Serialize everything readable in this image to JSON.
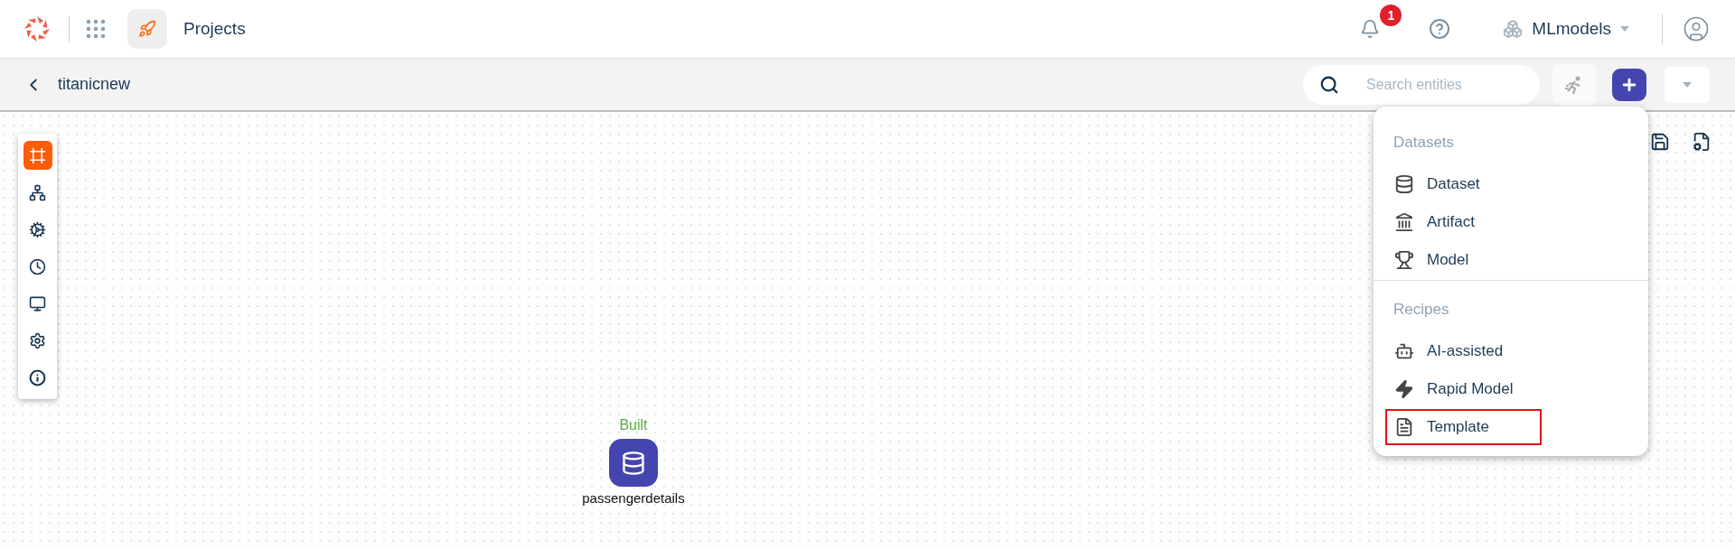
{
  "header": {
    "app_title": "Projects",
    "notifications": {
      "count": "1"
    },
    "workspace": "MLmodels"
  },
  "subheader": {
    "title": "titanicnew",
    "search": {
      "placeholder": "Search entities"
    }
  },
  "toolbar": {
    "items": [
      {
        "kind": "canvas",
        "selected": true
      },
      {
        "kind": "tree",
        "selected": false
      },
      {
        "kind": "pipeline",
        "selected": false
      },
      {
        "kind": "clock",
        "selected": false
      },
      {
        "kind": "dashboard",
        "selected": false
      },
      {
        "kind": "settings",
        "selected": false
      },
      {
        "kind": "info",
        "selected": false
      }
    ]
  },
  "canvas": {
    "nodes": [
      {
        "status": "Built",
        "label": "passengerdetails"
      }
    ]
  },
  "menu": {
    "sections": [
      {
        "title": "Datasets",
        "items": [
          {
            "kind": "dataset",
            "label": "Dataset",
            "selected": false
          },
          {
            "kind": "artifact",
            "label": "Artifact",
            "selected": false
          },
          {
            "kind": "model",
            "label": "Model",
            "selected": false
          }
        ]
      },
      {
        "title": "Recipes",
        "items": [
          {
            "kind": "robot",
            "label": "AI-assisted",
            "selected": false
          },
          {
            "kind": "bolt",
            "label": "Rapid Model",
            "selected": false
          },
          {
            "kind": "template",
            "label": "Template",
            "selected": true
          }
        ]
      }
    ]
  }
}
